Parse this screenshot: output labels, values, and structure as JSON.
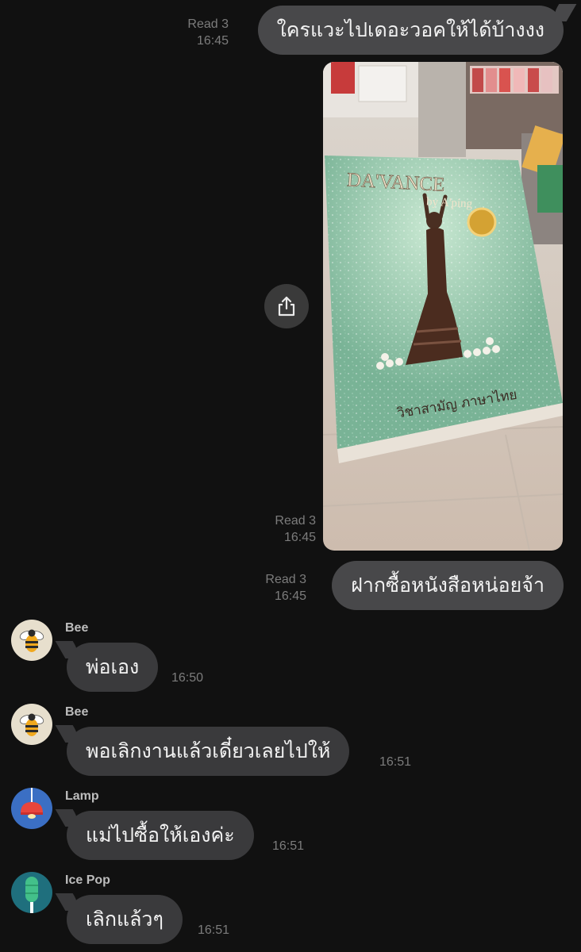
{
  "messages": [
    {
      "text": "ใครแวะไปเดอะวอคให้ได้บ้างงง",
      "read": "Read 3",
      "time": "16:45"
    },
    {
      "read": "Read 3",
      "time": "16:45",
      "photo": {
        "book_title": "DA'VANCE",
        "book_author": "by A'ping",
        "book_subject": "วิชาสามัญ ภาษาไทย"
      }
    },
    {
      "text": "ฝากซื้อหนังสือหน่อยจ้า",
      "read": "Read 3",
      "time": "16:45"
    },
    {
      "sender": "Bee",
      "text": "พ่อเอง",
      "time": "16:50"
    },
    {
      "sender": "Bee",
      "text": "พอเลิกงานแล้วเดี๋ยวเลยไปให้",
      "time": "16:51"
    },
    {
      "sender": "Lamp",
      "text": "แม่ไปซื้อให้เองค่ะ",
      "time": "16:51"
    },
    {
      "sender": "Ice Pop",
      "text": "เลิกแล้วๆ",
      "time": "16:51"
    }
  ],
  "icons": {
    "share": "share-icon",
    "bee_avatar": "bee-icon",
    "lamp_avatar": "lamp-icon",
    "icepop_avatar": "ice-pop-icon"
  },
  "colors": {
    "background": "#111111",
    "bubble_outgoing": "#48484a",
    "bubble_incoming": "#3a3a3c",
    "meta_text": "#7c7c7c"
  }
}
